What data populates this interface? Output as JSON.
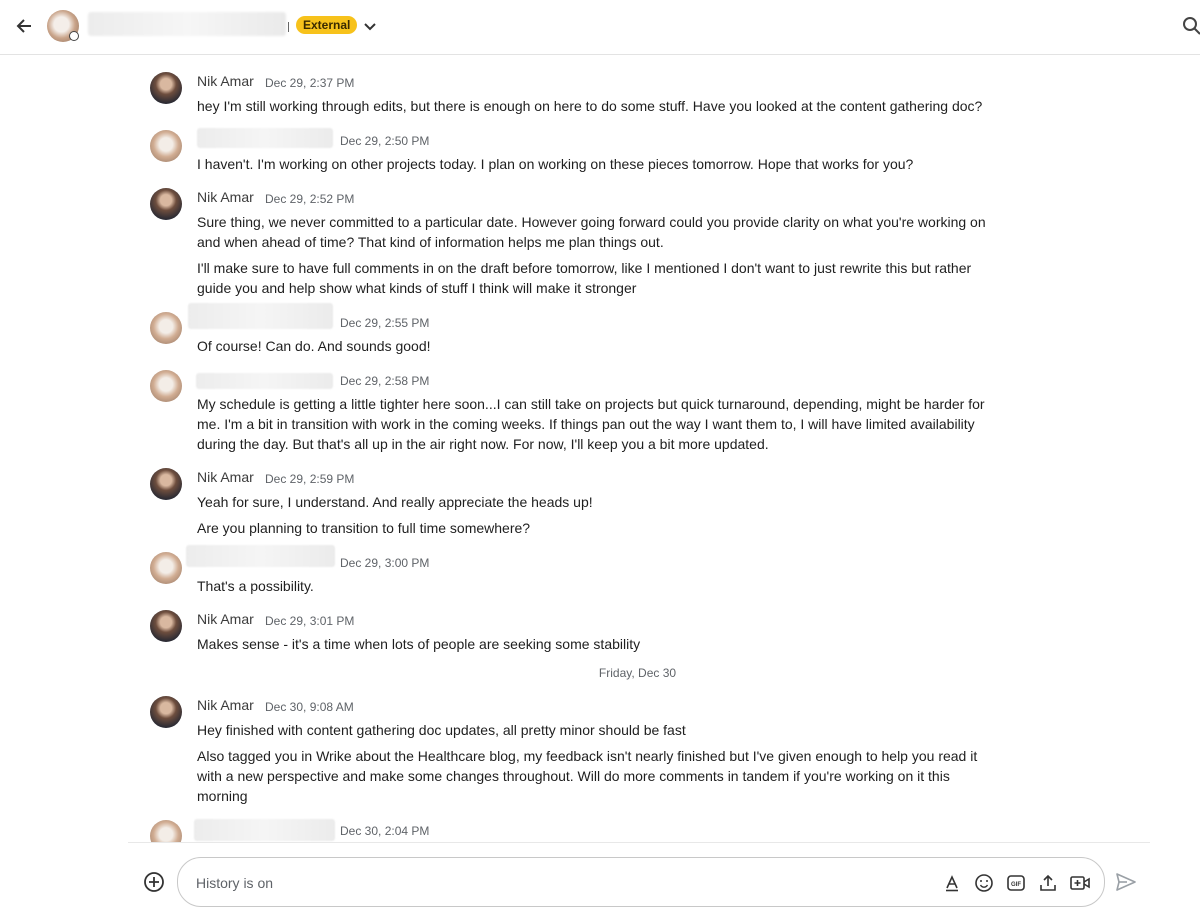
{
  "header": {
    "badge": "External",
    "icons": [
      "back-arrow-icon",
      "presence-icon",
      "chevron-down-icon",
      "search-icon"
    ]
  },
  "messages": [
    {
      "sender": "Nik Amar",
      "time": "Dec 29, 2:37 PM",
      "lines": [
        "hey I'm still working through edits, but there is enough on here to do some stuff. Have you looked at the content gathering doc?"
      ]
    },
    {
      "sender": "",
      "time": "Dec 29, 2:50 PM",
      "lines": [
        "I haven't. I'm working on other projects today. I plan on working on these pieces tomorrow. Hope that works for you?"
      ]
    },
    {
      "sender": "Nik Amar",
      "time": "Dec 29, 2:52 PM",
      "lines": [
        "Sure thing, we never committed to a particular date. However going forward could you provide clarity on what you're working on and when ahead of time? That kind of information helps me plan things out.",
        "I'll make sure to have full comments in on the draft before tomorrow, like I mentioned I don't want to just rewrite this but rather guide you and help show what kinds of stuff I think will make it stronger"
      ]
    },
    {
      "sender": "",
      "time": "Dec 29, 2:55 PM",
      "lines": [
        "Of course! Can do. And sounds good!"
      ]
    },
    {
      "sender": "",
      "time": "Dec 29, 2:58 PM",
      "lines": [
        "My schedule is getting a little tighter here soon...I can still take on projects but quick turnaround, depending, might be harder for me. I'm a bit in transition with work in the coming weeks. If things pan out the way I want them to, I will have limited availability during the day. But that's all up in the air right now. For now, I'll keep you a bit more updated."
      ]
    },
    {
      "sender": "Nik Amar",
      "time": "Dec 29, 2:59 PM",
      "lines": [
        "Yeah for sure, I understand. And really appreciate the heads up!",
        "Are you planning to transition to full time somewhere?"
      ]
    },
    {
      "sender": "",
      "time": "Dec 29, 3:00 PM",
      "lines": [
        "That's a possibility."
      ]
    },
    {
      "sender": "Nik Amar",
      "time": "Dec 29, 3:01 PM",
      "lines": [
        "Makes sense - it's a time when lots of people are seeking some stability"
      ]
    },
    {
      "sender": "Nik Amar",
      "time": "Dec 30, 9:08 AM",
      "lines": [
        "Hey finished with content gathering doc updates, all pretty minor should be fast",
        "Also tagged you in Wrike about the Healthcare blog, my feedback isn't nearly finished but I've given enough to help you read it with a new perspective and make some changes throughout. Will do more comments in tandem if you're working on it this morning"
      ]
    },
    {
      "sender": "",
      "time": "Dec 30, 2:04 PM",
      "lines": []
    }
  ],
  "date_divider": "Friday, Dec 30",
  "composer": {
    "placeholder": "History is on",
    "tools": [
      "format-text-icon",
      "emoji-icon",
      "gif-icon",
      "upload-icon",
      "video-meeting-icon"
    ],
    "send_icon": "send-icon",
    "add_icon": "add-circle-icon"
  }
}
